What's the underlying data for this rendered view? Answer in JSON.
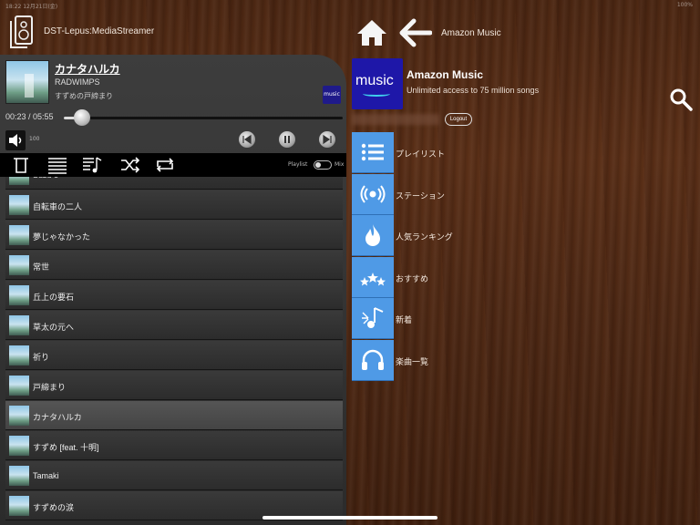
{
  "status_bar": {
    "left": "18:22  12月21日(金)",
    "right": "100%"
  },
  "header": {
    "device_name": "DST-Lepus:MediaStreamer",
    "nav_title": "Amazon Music"
  },
  "now_playing": {
    "title": "カナタハルカ",
    "artist": "RADWIMPS",
    "album": "すずめの戸締まり",
    "service_badge": "music",
    "time": "00:23 / 05:55",
    "progress": 0.065,
    "volume": "100"
  },
  "toolbar": {
    "playlist_label": "Playlist",
    "mix_label": "Mix"
  },
  "tracks": [
    {
      "title": "Suzu e"
    },
    {
      "title": "自転車の二人"
    },
    {
      "title": "夢じゃなかった"
    },
    {
      "title": "常世"
    },
    {
      "title": "丘上の要石"
    },
    {
      "title": "草太の元へ"
    },
    {
      "title": "祈り"
    },
    {
      "title": "戸締まり"
    },
    {
      "title": "カナタハルカ"
    },
    {
      "title": "すずめ [feat. 十明]"
    },
    {
      "title": "Tamaki"
    },
    {
      "title": "すずめの涙"
    }
  ],
  "current_track_index": 8,
  "service": {
    "logo_text": "music",
    "title": "Amazon Music",
    "subtitle": "Unlimited access to 75 million songs",
    "logout_label": "Logout"
  },
  "menu": [
    {
      "label": "プレイリスト",
      "icon": "list-icon"
    },
    {
      "label": "ステーション",
      "icon": "radio-icon"
    },
    {
      "label": "人気ランキング",
      "icon": "fire-icon"
    },
    {
      "label": "おすすめ",
      "icon": "stars-icon"
    },
    {
      "label": "新着",
      "icon": "new-music-icon"
    },
    {
      "label": "楽曲一覧",
      "icon": "headphones-icon"
    }
  ],
  "colors": {
    "menu_tile": "#4f9ae6",
    "amazon_logo": "#1e17a8"
  }
}
